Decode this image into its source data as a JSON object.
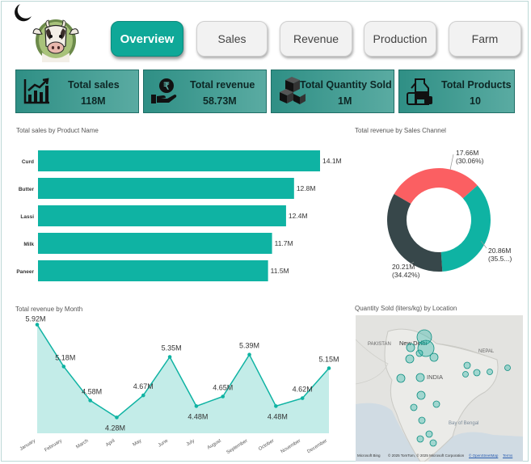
{
  "nav": {
    "buttons": [
      "Overview",
      "Sales",
      "Revenue",
      "Production",
      "Farm"
    ],
    "active": "Overview"
  },
  "kpis": [
    {
      "label": "Total sales",
      "value": "118M",
      "icon": "bar-chart-icon"
    },
    {
      "label": "Total revenue",
      "value": "58.73M",
      "icon": "rupee-hand-icon"
    },
    {
      "label": "Total Quantity Sold",
      "value": "1M",
      "icon": "boxes-icon"
    },
    {
      "label": "Total Products",
      "value": "10",
      "icon": "milk-products-icon"
    }
  ],
  "sales_by_product": {
    "title": "Total sales by Product Name"
  },
  "revenue_by_channel": {
    "title": "Total revenue by Sales Channel"
  },
  "revenue_by_month": {
    "title": "Total revenue by Month"
  },
  "quantity_map": {
    "title": "Quantity Sold (liters/kg) by Location",
    "labels": [
      "PAKISTAN",
      "New Delhi",
      "NEPAL",
      "INDIA",
      "Bay of Bengal"
    ],
    "attribution": "© 2025 TomTom, © 2025 Microsoft Corporation",
    "terms_link": "© OpenStreetMap",
    "terms": "Terms",
    "bing": "Microsoft Bing"
  },
  "chart_data": [
    {
      "type": "bar",
      "title": "Total sales by Product Name",
      "categories": [
        "Curd",
        "Butter",
        "Lassi",
        "Milk",
        "Paneer"
      ],
      "values": [
        14.1,
        12.8,
        12.4,
        11.7,
        11.5
      ],
      "value_labels": [
        "14.1M",
        "12.8M",
        "12.4M",
        "11.7M",
        "11.5M"
      ],
      "orientation": "horizontal",
      "color": "#0fb3a3"
    },
    {
      "type": "pie",
      "title": "Total revenue by Sales Channel",
      "donut": true,
      "slices": [
        {
          "value": 17.66,
          "label": "17.66M",
          "pct": "(30.06%)",
          "color": "#fb5f62"
        },
        {
          "value": 20.86,
          "label": "20.86M",
          "pct": "(35.5...)",
          "color": "#0fb3a3"
        },
        {
          "value": 20.21,
          "label": "20.21M",
          "pct": "(34.42%)",
          "color": "#37474a"
        }
      ]
    },
    {
      "type": "area",
      "title": "Total revenue by Month",
      "categories": [
        "January",
        "February",
        "March",
        "April",
        "May",
        "June",
        "July",
        "August",
        "September",
        "October",
        "November",
        "December"
      ],
      "values": [
        5.92,
        5.18,
        4.58,
        4.28,
        4.67,
        5.35,
        4.48,
        4.65,
        5.39,
        4.48,
        4.62,
        5.15
      ],
      "value_labels": [
        "5.92M",
        "5.18M",
        "4.58M",
        "4.28M",
        "4.67M",
        "5.35M",
        "4.48M",
        "4.65M",
        "5.39M",
        "4.48M",
        "4.62M",
        "5.15M"
      ],
      "ylim": [
        4.0,
        6.0
      ],
      "line_color": "#0fb3a3",
      "fill_color": "#c3ece8"
    }
  ]
}
